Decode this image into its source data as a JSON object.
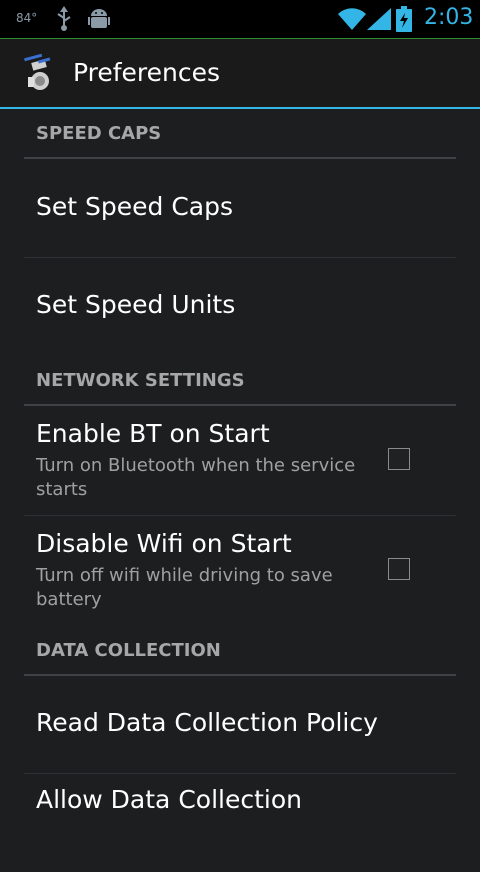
{
  "status_bar": {
    "temperature": "84°",
    "time": "2:03",
    "icons": [
      "usb-icon",
      "android-debug-icon",
      "wifi-icon",
      "signal-icon",
      "battery-charging-icon"
    ]
  },
  "action_bar": {
    "title": "Preferences",
    "icon": "app-icon"
  },
  "categories": {
    "speed_caps": "SPEED CAPS",
    "network_settings": "NETWORK SETTINGS",
    "data_collection": "DATA COLLECTION"
  },
  "items": {
    "set_speed_caps": {
      "title": "Set Speed Caps"
    },
    "set_speed_units": {
      "title": "Set Speed Units"
    },
    "enable_bt": {
      "title": "Enable BT on Start",
      "summary": "Turn on Bluetooth when the service starts",
      "checked": false
    },
    "disable_wifi": {
      "title": "Disable Wifi on Start",
      "summary": "Turn off wifi while driving to save battery",
      "checked": false
    },
    "read_policy": {
      "title": "Read Data Collection Policy"
    },
    "allow_data": {
      "title": "Allow Data Collection"
    }
  },
  "colors": {
    "accent": "#33b5e5",
    "background": "#1c1e20",
    "category_text": "#a7a7a7"
  }
}
